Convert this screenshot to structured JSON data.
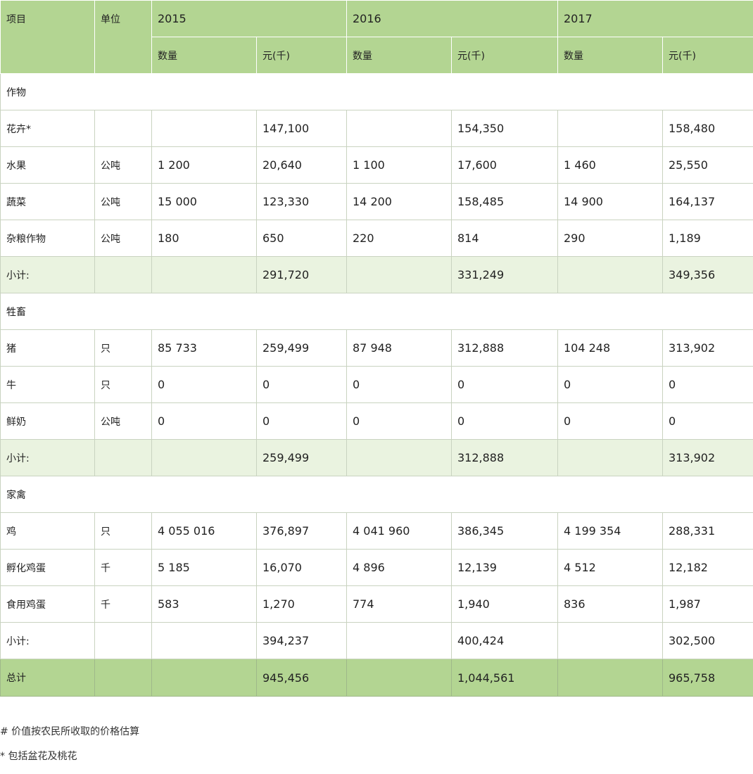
{
  "header": {
    "item": "项目",
    "unit": "单位",
    "years": [
      "2015",
      "2016",
      "2017"
    ],
    "qty": "数量",
    "value": "元(千)"
  },
  "sections": [
    {
      "name": "作物",
      "rows": [
        {
          "item": "花卉*",
          "unit": "",
          "cells": [
            "",
            "147,100",
            "",
            "154,350",
            "",
            "158,480"
          ]
        },
        {
          "item": "水果",
          "unit": "公吨",
          "cells": [
            "1 200",
            "20,640",
            "1 100",
            "17,600",
            "1 460",
            "25,550"
          ]
        },
        {
          "item": "蔬菜",
          "unit": "公吨",
          "cells": [
            "15 000",
            "123,330",
            "14 200",
            "158,485",
            "14 900",
            "164,137"
          ]
        },
        {
          "item": "杂粮作物",
          "unit": "公吨",
          "cells": [
            "180",
            "650",
            "220",
            "814",
            "290",
            "1,189"
          ]
        }
      ],
      "subtotal": {
        "label": "小计:",
        "cells": [
          "",
          "291,720",
          "",
          "331,249",
          "",
          "349,356"
        ]
      }
    },
    {
      "name": "牲畜",
      "rows": [
        {
          "item": "猪",
          "unit": "只",
          "cells": [
            "85 733",
            "259,499",
            "87 948",
            "312,888",
            "104 248",
            "313,902"
          ]
        },
        {
          "item": "牛",
          "unit": "只",
          "cells": [
            "0",
            "0",
            "0",
            "0",
            "0",
            "0"
          ]
        },
        {
          "item": "鲜奶",
          "unit": "公吨",
          "cells": [
            "0",
            "0",
            "0",
            "0",
            "0",
            "0"
          ]
        }
      ],
      "subtotal": {
        "label": "小计:",
        "cells": [
          "",
          "259,499",
          "",
          "312,888",
          "",
          "313,902"
        ]
      }
    },
    {
      "name": "家禽",
      "rows": [
        {
          "item": "鸡",
          "unit": "只",
          "cells": [
            "4 055 016",
            "376,897",
            "4 041 960",
            "386,345",
            "4 199 354",
            "288,331"
          ]
        },
        {
          "item": "孵化鸡蛋",
          "unit": "千",
          "cells": [
            "5 185",
            "16,070",
            "4 896",
            "12,139",
            "4 512",
            "12,182"
          ]
        },
        {
          "item": "食用鸡蛋",
          "unit": "千",
          "cells": [
            "583",
            "1,270",
            "774",
            "1,940",
            "836",
            "1,987"
          ]
        }
      ],
      "subtotal": {
        "label": "小计:",
        "cells": [
          "",
          "394,237",
          "",
          "400,424",
          "",
          "302,500"
        ]
      }
    }
  ],
  "total": {
    "label": "总计",
    "cells": [
      "",
      "945,456",
      "",
      "1,044,561",
      "",
      "965,758"
    ]
  },
  "notes": [
    "# 价值按农民所收取的价格估算",
    "* 包括盆花及桃花"
  ],
  "colors": {
    "header_bg": "#b3d592",
    "subtotal_bg": "#eaf3e0",
    "grid": "#c9d3c0"
  }
}
